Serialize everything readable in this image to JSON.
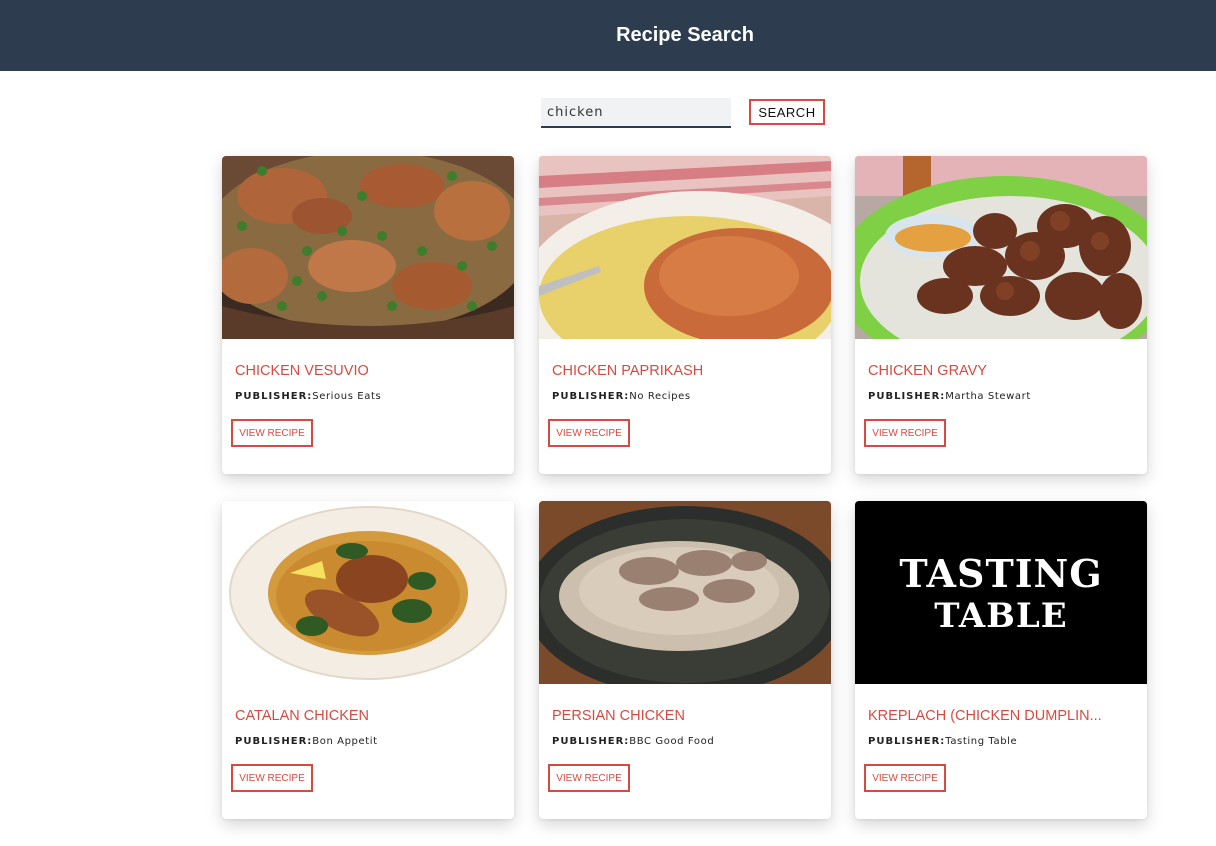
{
  "header": {
    "title": "Recipe Search"
  },
  "search": {
    "value": "chicken",
    "button_label": "SEARCH"
  },
  "recipes": [
    {
      "title": "Chicken Vesuvio",
      "publisher_label": "PUBLISHER:",
      "publisher": "Serious Eats",
      "button_label": "VIEW RECIPE",
      "image_icon": "chicken-vesuvio-photo"
    },
    {
      "title": "Chicken Paprikash",
      "publisher_label": "PUBLISHER:",
      "publisher": "No Recipes",
      "button_label": "VIEW RECIPE",
      "image_icon": "chicken-paprikash-photo"
    },
    {
      "title": "Chicken Gravy",
      "publisher_label": "PUBLISHER:",
      "publisher": "Martha Stewart",
      "button_label": "VIEW RECIPE",
      "image_icon": "chicken-gravy-photo"
    },
    {
      "title": "Catalan Chicken",
      "publisher_label": "PUBLISHER:",
      "publisher": "Bon Appetit",
      "button_label": "VIEW RECIPE",
      "image_icon": "catalan-chicken-photo"
    },
    {
      "title": "Persian Chicken",
      "publisher_label": "PUBLISHER:",
      "publisher": "BBC Good Food",
      "button_label": "VIEW RECIPE",
      "image_icon": "persian-chicken-photo"
    },
    {
      "title": "KREPLACH (CHICKEN DUMPLIN...",
      "publisher_label": "PUBLISHER:",
      "publisher": "Tasting Table",
      "button_label": "VIEW RECIPE",
      "image_icon": "tasting-table-logo"
    }
  ],
  "logo_text": {
    "line1": "TASTING",
    "line2": "TABLE"
  },
  "colors": {
    "header_bg": "#2e3c4f",
    "accent": "#d84a41",
    "text": "#222222"
  }
}
